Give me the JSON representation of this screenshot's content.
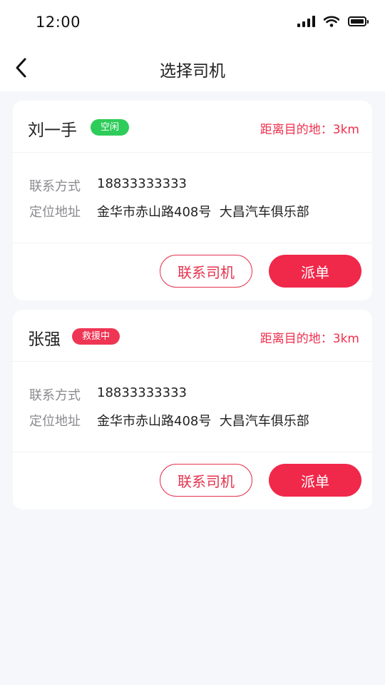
{
  "status_bar": {
    "time": "12:00",
    "icons": [
      "signal-icon",
      "wifi-icon",
      "battery-icon"
    ]
  },
  "header": {
    "title": "选择司机",
    "back_icon": "chevron-left-icon"
  },
  "labels": {
    "phone_label": "联系方式",
    "location_label": "定位地址",
    "contact_button": "联系司机",
    "dispatch_button": "派单"
  },
  "drivers": [
    {
      "name": "刘一手",
      "status": "空闲",
      "status_color": "#2ecc5a",
      "distance": "距离目的地：3km",
      "phone": "18833333333",
      "location": "金华市赤山路408号  大昌汽车俱乐部"
    },
    {
      "name": "张强",
      "status": "救援中",
      "status_color": "#ef3554",
      "distance": "距离目的地：3km",
      "phone": "18833333333",
      "location": "金华市赤山路408号  大昌汽车俱乐部"
    }
  ],
  "colors": {
    "accent": "#f0284a",
    "background": "#f6f7fb"
  }
}
